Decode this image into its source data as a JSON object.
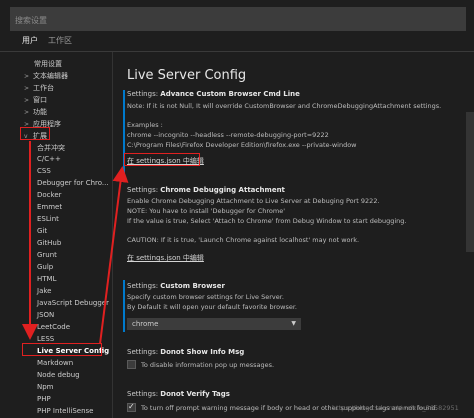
{
  "search": {
    "placeholder": "搜索设置"
  },
  "tabs": [
    {
      "label": "用户",
      "active": true
    },
    {
      "label": "工作区",
      "active": false
    }
  ],
  "sidebar": {
    "items": [
      {
        "label": "常用设置",
        "chevron": ""
      },
      {
        "label": "文本编辑器",
        "chevron": ">"
      },
      {
        "label": "工作台",
        "chevron": ">"
      },
      {
        "label": "窗口",
        "chevron": ">"
      },
      {
        "label": "功能",
        "chevron": ">"
      },
      {
        "label": "应用程序",
        "chevron": ">"
      },
      {
        "label": "扩展",
        "chevron": "v"
      },
      {
        "label": "合并冲突",
        "chevron": ""
      },
      {
        "label": "C/C++",
        "chevron": ""
      },
      {
        "label": "CSS",
        "chevron": ""
      },
      {
        "label": "Debugger for Chro...",
        "chevron": ""
      },
      {
        "label": "Docker",
        "chevron": ""
      },
      {
        "label": "Emmet",
        "chevron": ""
      },
      {
        "label": "ESLint",
        "chevron": ""
      },
      {
        "label": "Git",
        "chevron": ""
      },
      {
        "label": "GitHub",
        "chevron": ""
      },
      {
        "label": "Grunt",
        "chevron": ""
      },
      {
        "label": "Gulp",
        "chevron": ""
      },
      {
        "label": "HTML",
        "chevron": ""
      },
      {
        "label": "Jake",
        "chevron": ""
      },
      {
        "label": "JavaScript Debugger",
        "chevron": ""
      },
      {
        "label": "JSON",
        "chevron": ""
      },
      {
        "label": "LeetCode",
        "chevron": ""
      },
      {
        "label": "LESS",
        "chevron": ""
      },
      {
        "label": "Live Server Config",
        "chevron": ""
      },
      {
        "label": "Markdown",
        "chevron": ""
      },
      {
        "label": "Node debug",
        "chevron": ""
      },
      {
        "label": "Npm",
        "chevron": ""
      },
      {
        "label": "PHP",
        "chevron": ""
      },
      {
        "label": "PHP IntelliSense",
        "chevron": ""
      }
    ]
  },
  "main": {
    "title": "Live Server Config",
    "sections": {
      "cmdline": {
        "title_prefix": "Settings: ",
        "title": "Advance Custom Browser Cmd Line",
        "desc": [
          "Note: If it is not Null, It will override CustomBrowser and ChromeDebuggingAttachment settings.",
          "",
          "Examples :",
          "chrome --incognito --headless --remote-debugging-port=9222",
          "C:\\Program Files\\Firefox Developer Edition\\firefox.exe --private-window"
        ],
        "link": "在 settings.json 中编辑"
      },
      "chromedebug": {
        "title_prefix": "Settings: ",
        "title": "Chrome Debugging Attachment",
        "desc": [
          "Enable Chrome Debugging Attachment to Live Server at Debuging Port 9222.",
          "NOTE: You have to install 'Debugger for Chrome'",
          "If the value is true, Select 'Attach to Chrome' from Debug Window to start debugging.",
          "",
          "CAUTION: If it is true, 'Launch Chrome against localhost' may not work."
        ],
        "link": "在 settings.json 中编辑"
      },
      "custombrowser": {
        "title_prefix": "Settings: ",
        "title": "Custom Browser",
        "desc": [
          "Specify custom browser settings for Live Server.",
          "By Default it will open your default favorite browser."
        ],
        "select_value": "chrome"
      },
      "donotshow": {
        "title_prefix": "Settings: ",
        "title": "Donot Show Info Msg",
        "checkbox_label": "To disable information pop up messages.",
        "checked": false
      },
      "donotverify": {
        "title_prefix": "Settings: ",
        "title": "Donot Verify Tags",
        "checkbox_label": "To turn off prompt warning message if body or head or other supported tags are not found.",
        "checked": true
      }
    }
  },
  "watermark": "https://blog.csdn.net/weixin_36582951",
  "colors": {
    "accent": "#007acc",
    "annotation": "#e02020",
    "background": "#1e1e1e"
  }
}
